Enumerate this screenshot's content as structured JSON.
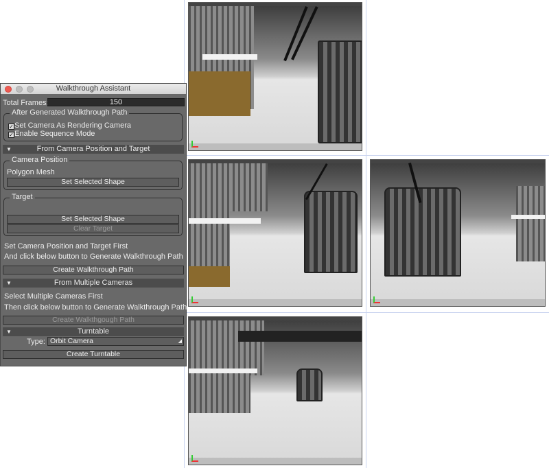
{
  "window": {
    "title": "Walkthrough Assistant"
  },
  "total_frames": {
    "label": "Total Frames:",
    "value": "150"
  },
  "after_group": {
    "title": "After Generated Walkthrough Path",
    "options": [
      {
        "label": "Set Camera As Rendering Camera",
        "checked": true
      },
      {
        "label": "Enable Sequence Mode",
        "checked": true
      }
    ]
  },
  "section_camera": {
    "title": "From Camera Position and Target",
    "expanded": true
  },
  "camera_position": {
    "title": "Camera Position",
    "value": "Polygon Mesh",
    "button": "Set Selected Shape"
  },
  "target": {
    "title": "Target",
    "value": "",
    "button": "Set Selected Shape",
    "clear_button": "Clear Target"
  },
  "instructions1": [
    "Set Camera Position and Target First",
    "And click below button to Generate Walkthrough Path"
  ],
  "create_path_button": "Create Walkthrough Path",
  "section_multi": {
    "title": "From Multiple Cameras",
    "expanded": true
  },
  "instructions2": [
    "Select Multiple Cameras First",
    "Then click below button to Generate Walkthrough Path"
  ],
  "create_multi_button": "Create Walkthgough Path",
  "section_turntable": {
    "title": "Turntable",
    "expanded": true
  },
  "turntable": {
    "type_label": "Type:",
    "type_value": "Orbit Camera",
    "button": "Create Turntable"
  },
  "colors": {
    "close": "#ee5a52",
    "panel": "#696969",
    "section": "#4c4c4c",
    "grid": "#c9d3ef"
  }
}
